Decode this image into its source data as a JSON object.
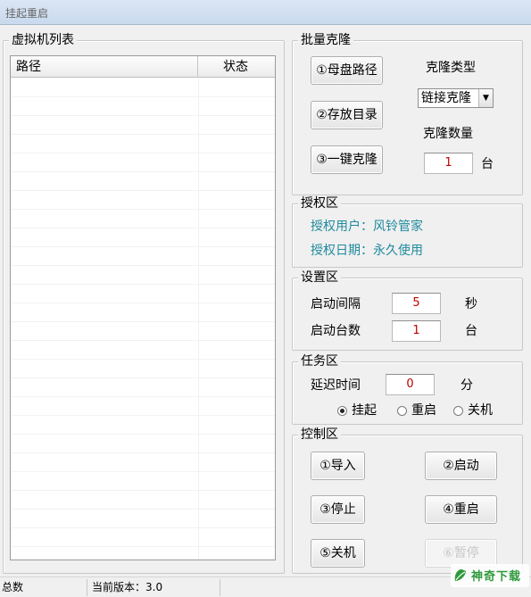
{
  "window": {
    "title": "挂起重启"
  },
  "vm_list": {
    "legend": "虚拟机列表",
    "columns": [
      "路径",
      "状态"
    ],
    "rows": []
  },
  "batch_clone": {
    "legend": "批量克隆",
    "btn_parent_disk": "①母盘路径",
    "btn_store_dir": "②存放目录",
    "btn_one_click": "③一键克隆",
    "type_label": "克隆类型",
    "type_selected": "链接克隆",
    "count_label": "克隆数量",
    "count_value": "1",
    "count_unit": "台"
  },
  "auth": {
    "legend": "授权区",
    "user": "授权用户：风铃管家",
    "date": "授权日期：永久使用"
  },
  "settings": {
    "legend": "设置区",
    "interval_label": "启动间隔",
    "interval_value": "5",
    "interval_unit": "秒",
    "count_label": "启动台数",
    "count_value": "1",
    "count_unit": "台"
  },
  "task": {
    "legend": "任务区",
    "delay_label": "延迟时间",
    "delay_value": "0",
    "delay_unit": "分",
    "options": [
      "挂起",
      "重启",
      "关机"
    ],
    "selected": "挂起"
  },
  "control": {
    "legend": "控制区",
    "btn_import": "①导入",
    "btn_start": "②启动",
    "btn_stop": "③停止",
    "btn_restart": "④重启",
    "btn_shutdown": "⑤关机",
    "btn_disabled": "⑥暂停"
  },
  "statusbar": {
    "total": "总数",
    "version": "当前版本：3.0"
  },
  "watermark": {
    "text": "神奇下载"
  },
  "colors": {
    "auth_text": "#1f8a9e",
    "field_value": "#c00000",
    "watermark": "#2f9a3c"
  }
}
